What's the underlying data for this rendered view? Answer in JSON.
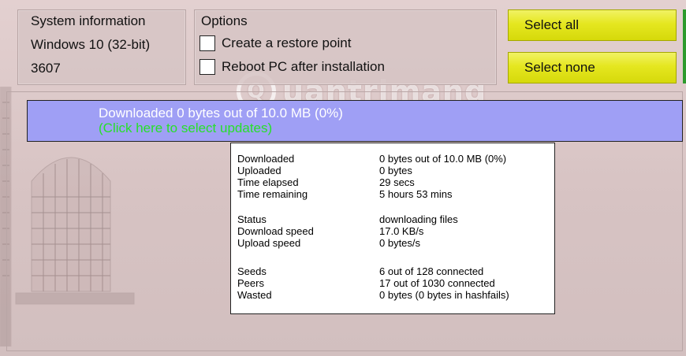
{
  "system_info": {
    "title": "System information",
    "os": "Windows 10 (32-bit)",
    "value": "3607"
  },
  "options": {
    "title": "Options",
    "items": [
      {
        "label": "Create a restore point",
        "checked": false
      },
      {
        "label": "Reboot PC after installation",
        "checked": false
      }
    ]
  },
  "buttons": {
    "select_all": "Select all",
    "select_none": "Select none"
  },
  "status": {
    "main": "Downloaded 0 bytes out of 10.0 MB (0%)",
    "link": "(Click here to select updates)"
  },
  "details": [
    {
      "key": "Downloaded",
      "value": "0 bytes out of 10.0 MB (0%)"
    },
    {
      "key": "Uploaded",
      "value": "0 bytes"
    },
    {
      "key": "Time elapsed",
      "value": "29 secs"
    },
    {
      "key": "Time remaining",
      "value": "5 hours 53 mins"
    },
    {
      "key": "Status",
      "value": "downloading files"
    },
    {
      "key": "Download speed",
      "value": "17.0 KB/s"
    },
    {
      "key": "Upload speed",
      "value": "0 bytes/s"
    },
    {
      "key": "Seeds",
      "value": "6 out of 128 connected"
    },
    {
      "key": "Peers",
      "value": "17 out of 1030 connected"
    },
    {
      "key": "Wasted",
      "value": "0 bytes (0 bytes in hashfails)"
    }
  ],
  "watermark": {
    "text": "uantrimang",
    "letter": "Q"
  },
  "colors": {
    "status_bar": "#9f9ff5",
    "link": "#27e02a",
    "button": "#e5e720"
  }
}
